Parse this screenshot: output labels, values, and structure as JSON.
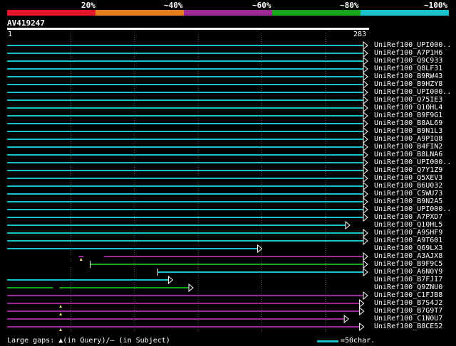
{
  "legend": {
    "labels": [
      "20%",
      "~40%",
      "~60%",
      "~80%",
      "~100%"
    ],
    "colors": [
      "#e4142b",
      "#e87d1e",
      "#9b2a96",
      "#1aa51a",
      "#18c2c9"
    ]
  },
  "query": {
    "title": "AV419247",
    "start_label": "1",
    "end_label": "283"
  },
  "hits": [
    {
      "label": "UniRef100_UPI000..",
      "color": "cyan",
      "q": [
        0,
        283
      ]
    },
    {
      "label": "UniRef100_A7P1H6",
      "color": "cyan",
      "q": [
        0,
        283
      ]
    },
    {
      "label": "UniRef100_Q9C933",
      "color": "cyan",
      "q": [
        0,
        283
      ]
    },
    {
      "label": "UniRef100_Q8LF31",
      "color": "cyan",
      "q": [
        0,
        283
      ]
    },
    {
      "label": "UniRef100_B9RW43",
      "color": "cyan",
      "q": [
        0,
        283
      ]
    },
    {
      "label": "UniRef100_B9HZY8",
      "color": "cyan",
      "q": [
        0,
        283
      ]
    },
    {
      "label": "UniRef100_UPI000..",
      "color": "cyan",
      "q": [
        0,
        283
      ]
    },
    {
      "label": "UniRef100_Q75IE3",
      "color": "cyan",
      "q": [
        0,
        283
      ]
    },
    {
      "label": "UniRef100_Q10HL4",
      "color": "cyan",
      "q": [
        0,
        283
      ]
    },
    {
      "label": "UniRef100_B9F9G1",
      "color": "cyan",
      "q": [
        0,
        283
      ]
    },
    {
      "label": "UniRef100_B8AL69",
      "color": "cyan",
      "q": [
        0,
        283
      ]
    },
    {
      "label": "UniRef100_B9N1L3",
      "color": "cyan",
      "q": [
        0,
        283
      ]
    },
    {
      "label": "UniRef100_A9PIQ8",
      "color": "cyan",
      "q": [
        0,
        283
      ]
    },
    {
      "label": "UniRef100_B4FIN2",
      "color": "cyan",
      "q": [
        0,
        283
      ]
    },
    {
      "label": "UniRef100_B8LNA6",
      "color": "cyan",
      "q": [
        0,
        283
      ]
    },
    {
      "label": "UniRef100_UPI000..",
      "color": "cyan",
      "q": [
        0,
        283
      ]
    },
    {
      "label": "UniRef100_Q7Y1Z9",
      "color": "cyan",
      "q": [
        0,
        283
      ]
    },
    {
      "label": "UniRef100_Q5XEV3",
      "color": "cyan",
      "q": [
        0,
        283
      ]
    },
    {
      "label": "UniRef100_B6U032",
      "color": "cyan",
      "q": [
        0,
        283
      ]
    },
    {
      "label": "UniRef100_C5WU73",
      "color": "cyan",
      "q": [
        0,
        283
      ]
    },
    {
      "label": "UniRef100_B9N2A5",
      "color": "cyan",
      "q": [
        0,
        283
      ]
    },
    {
      "label": "UniRef100_UPI000..",
      "color": "cyan",
      "q": [
        0,
        283
      ]
    },
    {
      "label": "UniRef100_A7PXD7",
      "color": "cyan",
      "q": [
        0,
        283
      ]
    },
    {
      "label": "UniRef100_Q10HL5",
      "color": "cyan",
      "q": [
        0,
        269
      ]
    },
    {
      "label": "UniRef100_A9SHF9",
      "color": "cyan",
      "q": [
        0,
        283
      ]
    },
    {
      "label": "UniRef100_A9T601",
      "color": "cyan",
      "q": [
        0,
        283
      ]
    },
    {
      "label": "UniRef100_Q69LX3",
      "color": "cyan",
      "q": [
        0,
        200
      ]
    },
    {
      "label": "UniRef100_A3AJX8",
      "color": "purple",
      "q": [
        0,
        283
      ],
      "dark": [
        [
          0,
          56
        ],
        [
          60,
          76
        ]
      ],
      "gap": 58
    },
    {
      "label": "UniRef100_B9F9C5",
      "color": "green",
      "q": [
        0,
        283
      ],
      "dark": [
        [
          0,
          65
        ]
      ],
      "tick": 65
    },
    {
      "label": "UniRef100_A6N0Y9",
      "color": "cyan",
      "q": [
        118,
        283
      ],
      "tick": 118
    },
    {
      "label": "UniRef100_B7FJI7",
      "color": "cyan",
      "q": [
        0,
        130
      ]
    },
    {
      "label": "UniRef100_Q9ZNU0",
      "color": "green",
      "q": [
        0,
        146
      ],
      "dark": [
        [
          36,
          41
        ]
      ]
    },
    {
      "label": "UniRef100_C1FJB8",
      "color": "purple",
      "q": [
        0,
        283
      ]
    },
    {
      "label": "UniRef100_B7S4J2",
      "color": "purple",
      "q": [
        0,
        280
      ],
      "gap": 42
    },
    {
      "label": "UniRef100_B7G9T7",
      "color": "purple",
      "q": [
        0,
        280
      ],
      "gap": 42
    },
    {
      "label": "UniRef100_C1N0U7",
      "color": "purple",
      "q": [
        0,
        268
      ]
    },
    {
      "label": "UniRef100_B8CE52",
      "color": "purple",
      "q": [
        0,
        280
      ],
      "gap": 42
    }
  ],
  "footer": {
    "left": "Large gaps: ▲(in Query)/– (in Subject)",
    "right": "=50char."
  },
  "colors": {
    "cyan": "#18c2c9",
    "purple": "#9b2a96",
    "green": "#1aa51a",
    "gap": "#f5e07a",
    "grid": "#666666"
  }
}
